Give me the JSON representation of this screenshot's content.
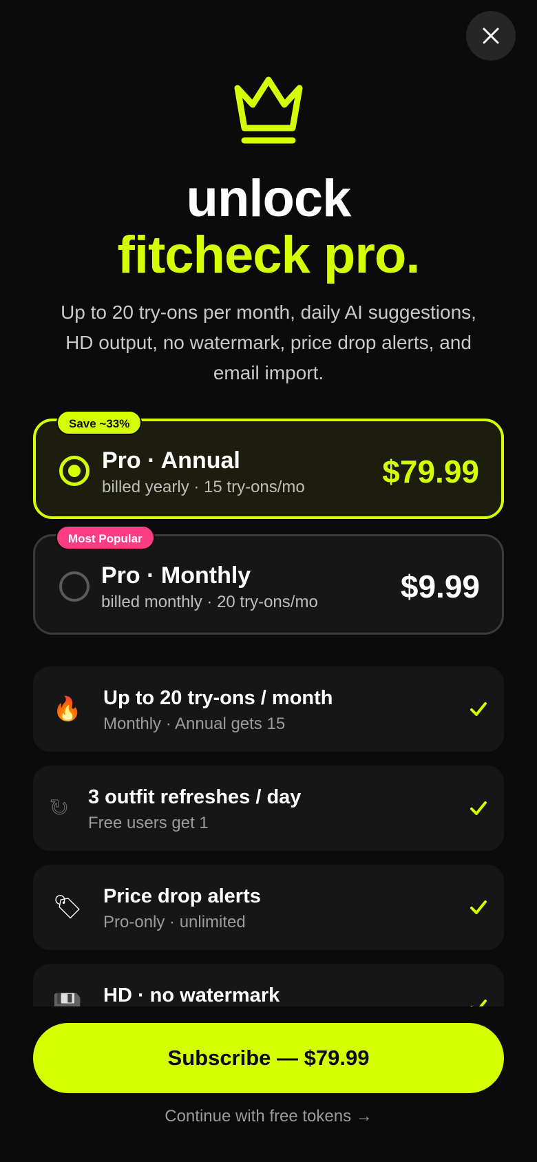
{
  "header": {
    "close_icon": "close-icon",
    "crown_icon": "crown-icon",
    "title_line1": "unlock",
    "title_line2": "fitcheck pro.",
    "subtitle": "Up to 20 try-ons per month, daily AI suggestions, HD output, no watermark, price drop alerts, and email import."
  },
  "plans": [
    {
      "badge": "Save ~33%",
      "name": "Pro · Annual",
      "description": "billed yearly · 15 try-ons/mo",
      "price": "$79.99",
      "selected": true
    },
    {
      "badge": "Most Popular",
      "name": "Pro · Monthly",
      "description": "billed monthly · 20 try-ons/mo",
      "price": "$9.99",
      "selected": false
    }
  ],
  "features": [
    {
      "icon": "fire-icon",
      "glyph": "🔥",
      "title": "Up to 20 try-ons / month",
      "subtitle": "Monthly · Annual gets 15"
    },
    {
      "icon": "refresh-icon",
      "glyph": "↻",
      "title": "3 outfit refreshes / day",
      "subtitle": "Free users get 1"
    },
    {
      "icon": "price-tag-icon",
      "glyph": "🏷",
      "title": "Price drop alerts",
      "subtitle": "Pro-only · unlimited"
    },
    {
      "icon": "floppy-disk-icon",
      "glyph": "💾",
      "title": "HD · no watermark",
      "subtitle": ""
    }
  ],
  "cta": {
    "subscribe_label": "Subscribe — $79.99",
    "free_link_label": "Continue with free tokens →"
  },
  "colors": {
    "accent": "#d4ff00",
    "badge_pink": "#ff3d84",
    "background": "#0b0b0b"
  }
}
